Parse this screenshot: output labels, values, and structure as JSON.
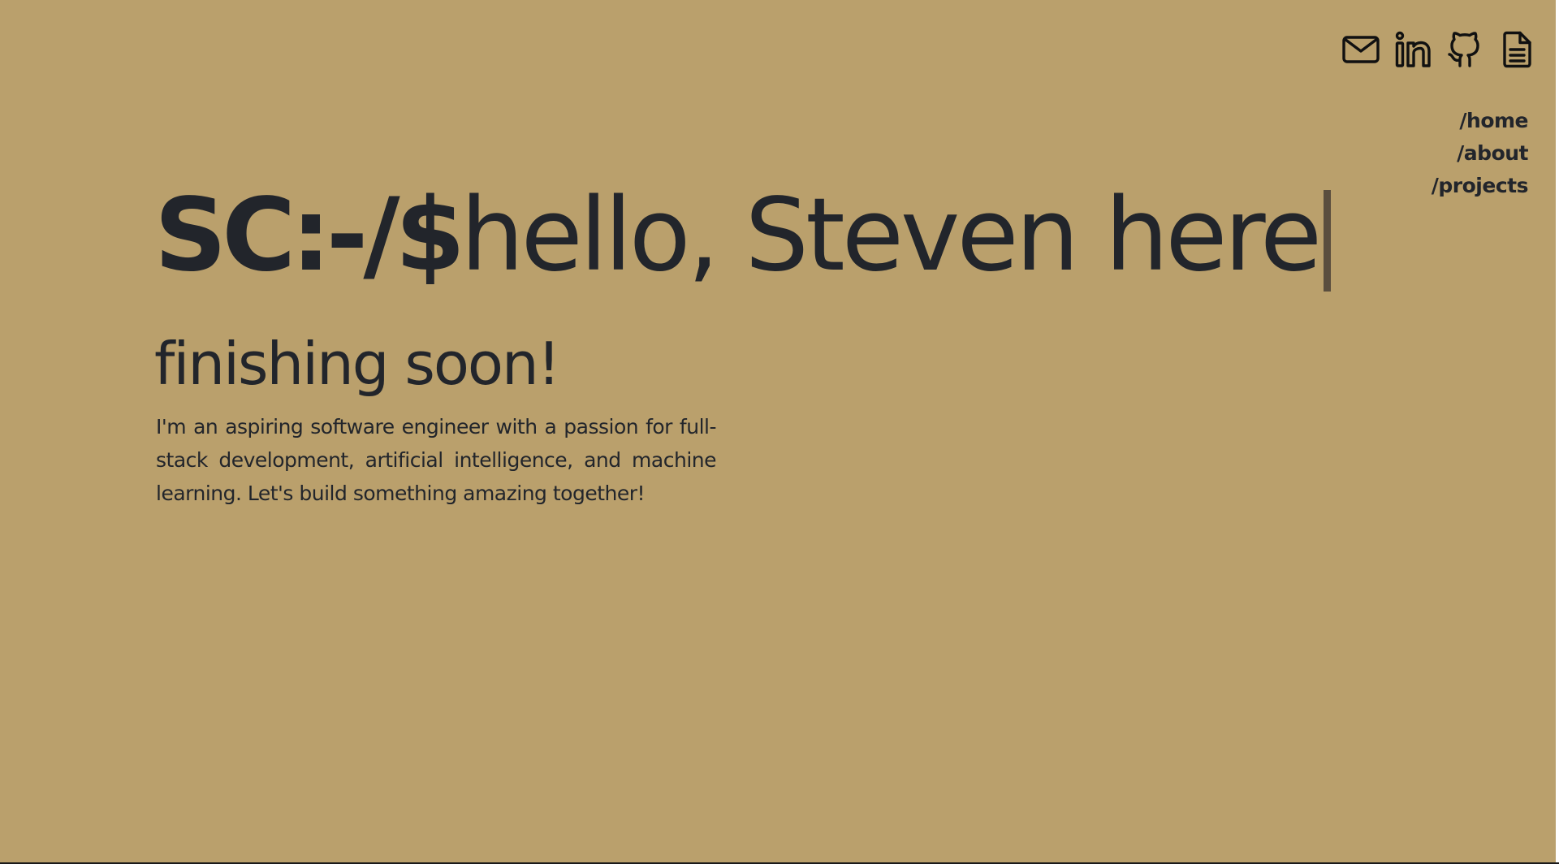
{
  "social": {
    "icons": [
      {
        "name": "mail-icon",
        "label": "email"
      },
      {
        "name": "linkedin-icon",
        "label": "linkedin"
      },
      {
        "name": "github-icon",
        "label": "github"
      },
      {
        "name": "document-icon",
        "label": "resume"
      }
    ]
  },
  "nav": {
    "items": [
      {
        "label": "/home"
      },
      {
        "label": "/about"
      },
      {
        "label": "/projects"
      }
    ]
  },
  "hero": {
    "prompt": "SC:-/$",
    "greeting": "hello, Steven here"
  },
  "subtitle": "finishing soon!",
  "bio": "I'm an aspiring software engineer with a passion for full-stack development, artificial intelligence, and machine learning. Let's build something amazing together!",
  "colors": {
    "background": "#baa06c",
    "text": "#22252b",
    "cursor": "#5a4e3e"
  }
}
